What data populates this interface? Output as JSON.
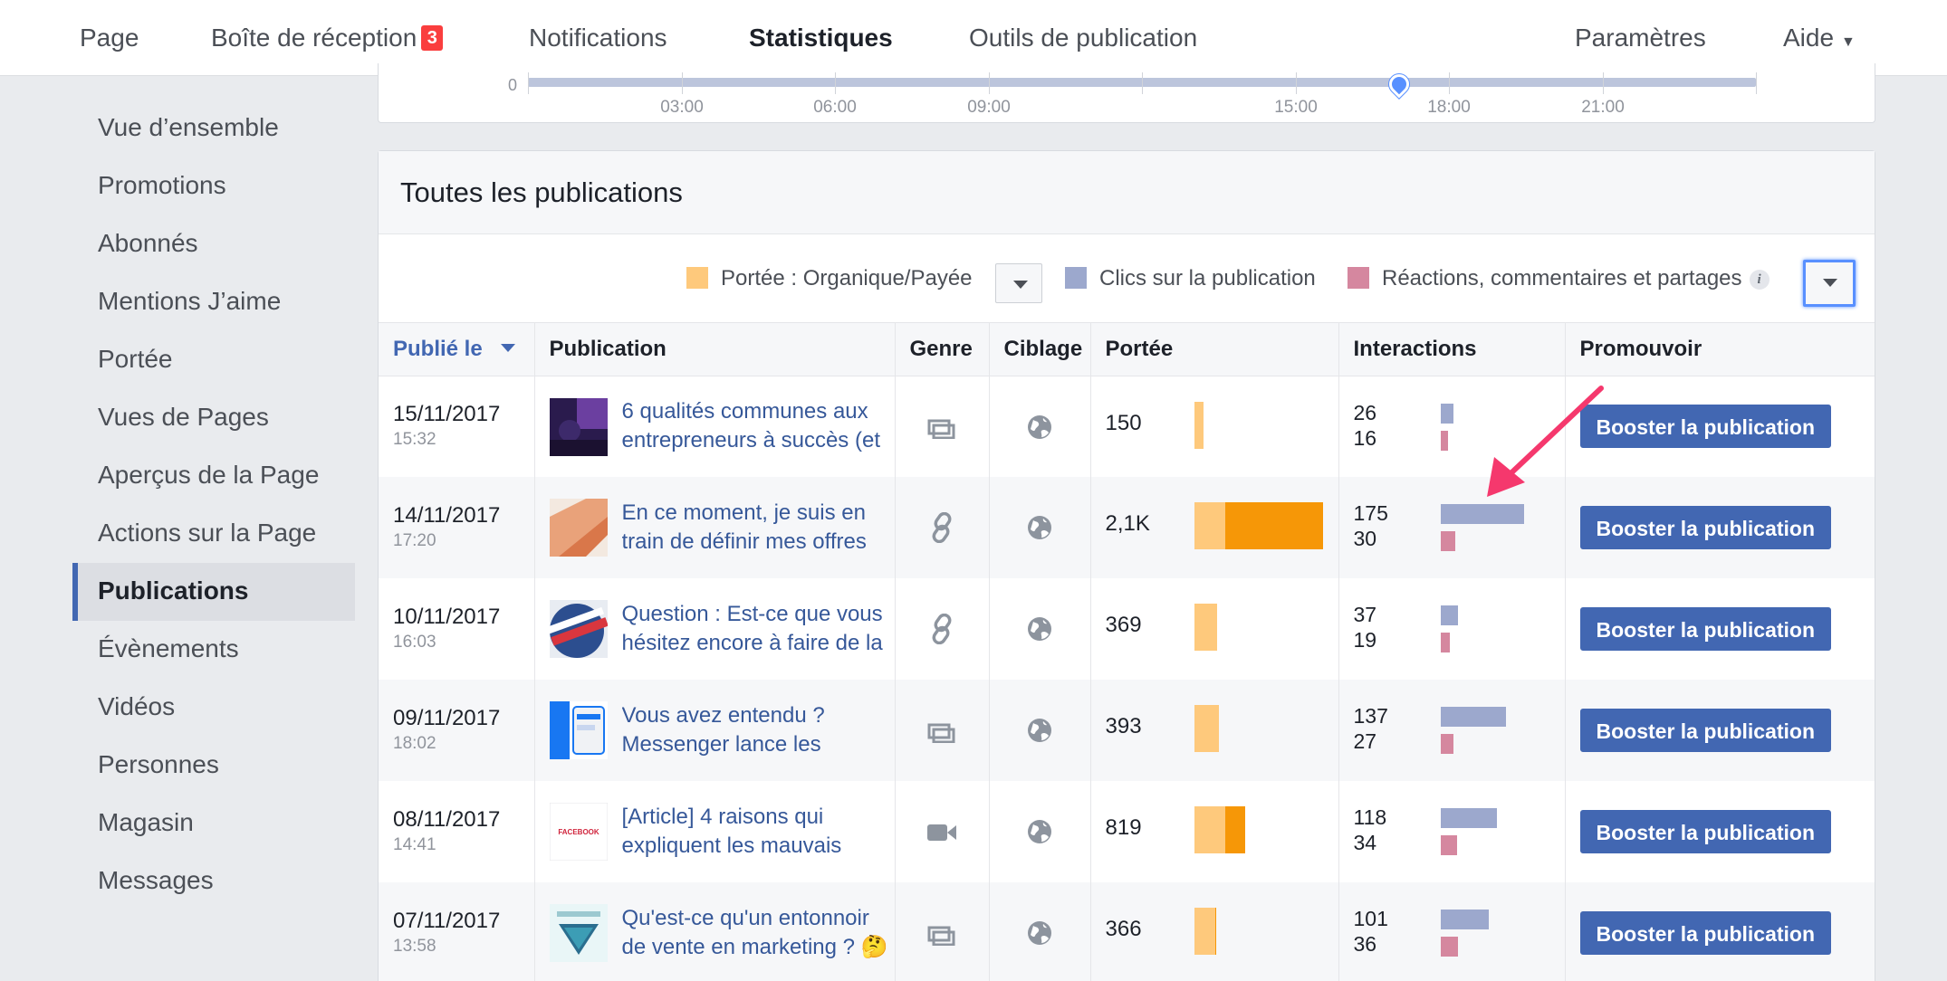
{
  "nav": {
    "tabs": [
      {
        "label": "Page"
      },
      {
        "label": "Boîte de réception",
        "badge": "3"
      },
      {
        "label": "Notifications"
      },
      {
        "label": "Statistiques",
        "active": true
      },
      {
        "label": "Outils de publication"
      }
    ],
    "right": [
      {
        "label": "Paramètres"
      },
      {
        "label": "Aide"
      }
    ]
  },
  "sidebar": {
    "items": [
      {
        "label": "Vue d’ensemble"
      },
      {
        "label": "Promotions"
      },
      {
        "label": "Abonnés"
      },
      {
        "label": "Mentions J’aime"
      },
      {
        "label": "Portée"
      },
      {
        "label": "Vues de Pages"
      },
      {
        "label": "Aperçus de la Page"
      },
      {
        "label": "Actions sur la Page"
      },
      {
        "label": "Publications",
        "active": true
      },
      {
        "label": "Évènements"
      },
      {
        "label": "Vidéos"
      },
      {
        "label": "Personnes"
      },
      {
        "label": "Magasin"
      },
      {
        "label": "Messages"
      }
    ]
  },
  "timeline": {
    "zero": "0",
    "labels": [
      "03:00",
      "06:00",
      "09:00",
      "15:00",
      "18:00",
      "21:00"
    ]
  },
  "posts": {
    "title": "Toutes les publications",
    "legend": {
      "reach": "Portée : Organique/Payée",
      "clicks": "Clics sur la publication",
      "reactions": "Réactions, commentaires et partages",
      "info": "i"
    },
    "colors": {
      "organic": "#fec97c",
      "paid": "#f69707",
      "clicks": "#9ca8cd",
      "reactions": "#d5879f",
      "button": "#4267b2",
      "link": "#365899"
    },
    "columns": {
      "date": "Publié le",
      "publication": "Publication",
      "type": "Genre",
      "targeting": "Ciblage",
      "reach": "Portée",
      "interactions": "Interactions",
      "promote": "Promouvoir"
    },
    "rows": [
      {
        "date": "15/11/2017",
        "time": "15:32",
        "title": "6 qualités communes aux entrepreneurs à succès (et",
        "type_icon": "album-icon",
        "reach": "150",
        "organic": 150,
        "paid": 0,
        "clicks": "26",
        "reactions": "16",
        "clicks_n": 26,
        "reactions_n": 16,
        "button": "Booster la publication"
      },
      {
        "date": "14/11/2017",
        "time": "17:20",
        "title": "En ce moment, je suis en train de définir mes offres",
        "type_icon": "link-icon",
        "reach": "2,1K",
        "organic": 500,
        "paid": 1600,
        "clicks": "175",
        "reactions": "30",
        "clicks_n": 175,
        "reactions_n": 30,
        "button": "Booster la publication"
      },
      {
        "date": "10/11/2017",
        "time": "16:03",
        "title": "Question : Est-ce que vous hésitez encore à faire de la",
        "type_icon": "link-icon",
        "reach": "369",
        "organic": 369,
        "paid": 0,
        "clicks": "37",
        "reactions": "19",
        "clicks_n": 37,
        "reactions_n": 19,
        "button": "Booster la publication"
      },
      {
        "date": "09/11/2017",
        "time": "18:02",
        "title": "Vous avez entendu ? Messenger lance les",
        "type_icon": "album-icon",
        "reach": "393",
        "organic": 393,
        "paid": 0,
        "clicks": "137",
        "reactions": "27",
        "clicks_n": 137,
        "reactions_n": 27,
        "button": "Booster la publication"
      },
      {
        "date": "08/11/2017",
        "time": "14:41",
        "title": "[Article] 4 raisons qui expliquent les mauvais",
        "type_icon": "video-icon",
        "reach": "819",
        "organic": 500,
        "paid": 319,
        "clicks": "118",
        "reactions": "34",
        "clicks_n": 118,
        "reactions_n": 34,
        "button": "Booster la publication"
      },
      {
        "date": "07/11/2017",
        "time": "13:58",
        "title": "Qu'est-ce qu'un entonnoir de vente en marketing ? 🤔",
        "type_icon": "album-icon",
        "reach": "366",
        "organic": 346,
        "paid": 20,
        "clicks": "101",
        "reactions": "36",
        "clicks_n": 101,
        "reactions_n": 36,
        "button": "Booster la publication"
      }
    ]
  }
}
